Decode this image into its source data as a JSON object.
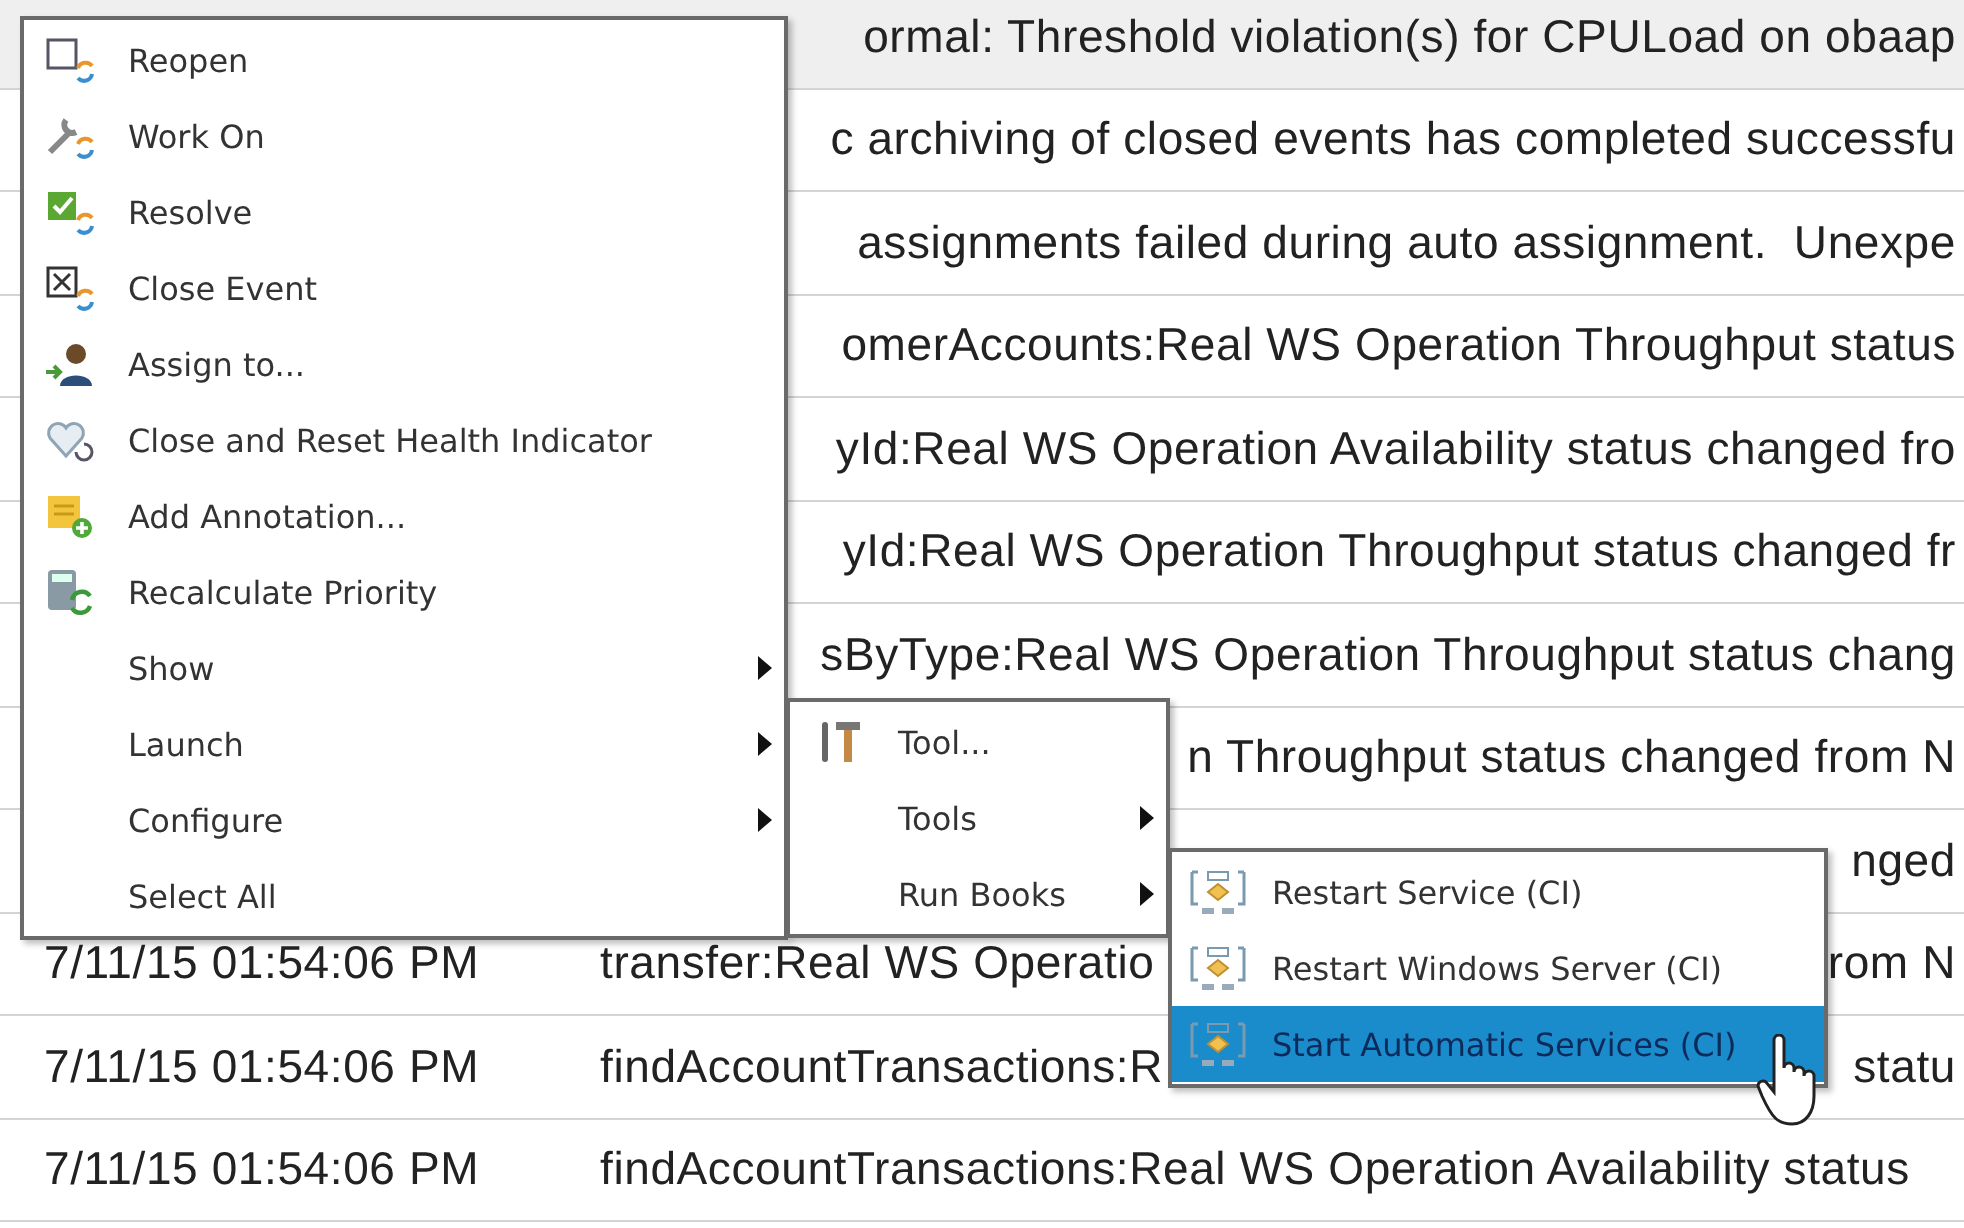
{
  "events": {
    "rows": [
      {
        "selected": true,
        "message_parts": [
          "ormal: Threshold violation(s) for CPULoad on obaap"
        ]
      },
      {
        "selected": false,
        "message_parts": [
          "c archiving of closed events has completed successfu"
        ]
      },
      {
        "selected": false,
        "message_parts": [
          "assignments failed during auto assignment.  Unexpe"
        ]
      },
      {
        "selected": false,
        "message_parts": [
          "omerAccounts:Real WS Operation Throughput status"
        ]
      },
      {
        "selected": false,
        "message_parts": [
          "yId:Real WS Operation Availability status changed fro"
        ]
      },
      {
        "selected": false,
        "message_parts": [
          "yId:Real WS Operation Throughput status changed fr"
        ]
      },
      {
        "selected": false,
        "message_parts": [
          "sByType:Real WS Operation Throughput status chang"
        ]
      },
      {
        "selected": false,
        "message_parts": [
          "n Throughput status changed from N"
        ]
      },
      {
        "selected": false,
        "message_parts": [
          "nged"
        ]
      },
      {
        "selected": false,
        "time": "7/11/15 01:54:06 PM",
        "message_parts": [
          "transfer:Real WS Operatio",
          "rom N"
        ]
      },
      {
        "selected": false,
        "time": "7/11/15 01:54:06 PM",
        "message_parts": [
          "findAccountTransactions:R",
          "statu"
        ]
      },
      {
        "selected": false,
        "time": "7/11/15 01:54:06 PM",
        "message_parts": [
          "findAccountTransactions:Real WS Operation Availability status"
        ]
      }
    ]
  },
  "context_menu": {
    "items": [
      {
        "kind": "action",
        "label": "Reopen",
        "selected": false
      },
      {
        "kind": "action",
        "label": "Work On",
        "selected": false
      },
      {
        "kind": "action",
        "label": "Resolve",
        "selected": false
      },
      {
        "kind": "action",
        "label": "Close Event",
        "selected": false
      },
      {
        "kind": "action",
        "label": "Assign to...",
        "selected": false
      },
      {
        "kind": "action",
        "label": "Close and Reset Health Indicator",
        "selected": false
      },
      {
        "kind": "action",
        "label": "Add Annotation...",
        "selected": false
      },
      {
        "kind": "action",
        "label": "Recalculate Priority",
        "selected": false
      },
      {
        "kind": "submenu",
        "label": "Show",
        "selected": false
      },
      {
        "kind": "submenu",
        "label": "Launch",
        "selected": false,
        "children": [
          {
            "kind": "action",
            "label": "Tool...",
            "selected": false
          },
          {
            "kind": "submenu",
            "label": "Tools",
            "selected": false
          },
          {
            "kind": "submenu",
            "label": "Run Books",
            "selected": false,
            "children": [
              {
                "kind": "action",
                "label": "Restart Service (CI)",
                "selected": false
              },
              {
                "kind": "action",
                "label": "Restart Windows Server (CI)",
                "selected": false
              },
              {
                "kind": "action",
                "label": "Start Automatic Services (CI)",
                "selected": true
              }
            ]
          }
        ]
      },
      {
        "kind": "submenu",
        "label": "Configure",
        "selected": false
      },
      {
        "kind": "plain",
        "label": "Select All",
        "selected": false
      }
    ]
  }
}
